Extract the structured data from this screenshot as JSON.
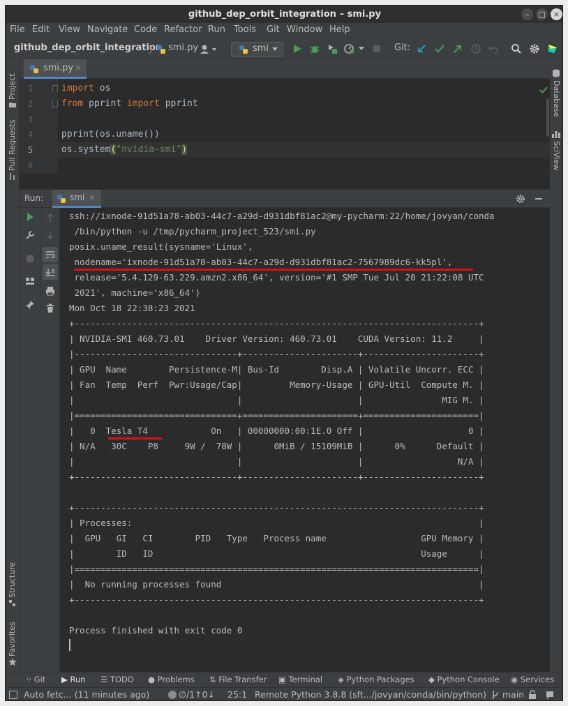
{
  "window": {
    "title": "github_dep_orbit_integration – smi.py",
    "minimize": "–",
    "maximize": "□",
    "close": "×"
  },
  "menu": [
    "File",
    "Edit",
    "View",
    "Navigate",
    "Code",
    "Refactor",
    "Run",
    "Tools",
    "Git",
    "Window",
    "Help"
  ],
  "navbar": {
    "project": "github_dep_orbit_integration",
    "file": "smi.py",
    "run_config": "smi",
    "git_label": "Git:"
  },
  "left_strip": {
    "project": "Project",
    "pull_requests": "Pull Requests",
    "structure": "Structure",
    "favorites": "Favorites"
  },
  "right_strip": {
    "database": "Database",
    "sciview": "SciView"
  },
  "editor": {
    "tab": "smi.py",
    "lines": [
      {
        "n": "1",
        "text": "import os"
      },
      {
        "n": "2",
        "text": "from pprint import pprint"
      },
      {
        "n": "3",
        "text": ""
      },
      {
        "n": "4",
        "text": "pprint(os.uname())"
      },
      {
        "n": "5",
        "text": "os.system(\"nvidia-smi\")"
      },
      {
        "n": "6",
        "text": ""
      }
    ],
    "kw_import": "import",
    "kw_from": "from",
    "mod_os": "os",
    "mod_pprint": "pprint",
    "line4": "pprint(os.uname())",
    "line5_a": "os.system",
    "line5_paren_open": "(",
    "line5_str": "\"nvidia-smi\"",
    "line5_paren_close": ")"
  },
  "run": {
    "label": "Run:",
    "tab": "smi",
    "output": [
      "ssh://ixnode-91d51a78-ab03-44c7-a29d-d931dbf81ac2@my-pycharm:22/home/jovyan/conda",
      " /bin/python -u /tmp/pycharm_project_523/smi.py",
      "posix.uname_result(sysname='Linux',",
      " nodename='ixnode-91d51a78-ab03-44c7-a29d-d931dbf81ac2-7567989dc6-kk5pl',",
      " release='5.4.129-63.229.amzn2.x86_64', version='#1 SMP Tue Jul 20 21:22:08 UTC",
      " 2021', machine='x86_64')",
      "Mon Oct 18 22:38:23 2021",
      "+-----------------------------------------------------------------------------+",
      "| NVIDIA-SMI 460.73.01    Driver Version: 460.73.01    CUDA Version: 11.2     |",
      "|-------------------------------+----------------------+----------------------+",
      "| GPU  Name        Persistence-M| Bus-Id        Disp.A | Volatile Uncorr. ECC |",
      "| Fan  Temp  Perf  Pwr:Usage/Cap|         Memory-Usage | GPU-Util  Compute M. |",
      "|                               |                      |               MIG M. |",
      "|===============================+======================+======================|",
      "|   0  Tesla T4            On   | 00000000:00:1E.0 Off |                    0 |",
      "| N/A   30C    P8     9W /  70W |      0MiB / 15109MiB |      0%      Default |",
      "|                               |                      |                  N/A |",
      "+-------------------------------+----------------------+----------------------+",
      "",
      "+-----------------------------------------------------------------------------+",
      "| Processes:                                                                  |",
      "|  GPU   GI   CI        PID   Type   Process name                  GPU Memory |",
      "|        ID   ID                                                   Usage      |",
      "|=============================================================================|",
      "|  No running processes found                                                 |",
      "+-----------------------------------------------------------------------------+",
      "",
      "Process finished with exit code 0"
    ]
  },
  "bottom_tools": [
    {
      "icon": "git-icon",
      "label": "Git"
    },
    {
      "icon": "run-icon",
      "label": "Run"
    },
    {
      "icon": "todo-icon",
      "label": "TODO"
    },
    {
      "icon": "problems-icon",
      "label": "Problems"
    },
    {
      "icon": "file-transfer-icon",
      "label": "File Transfer"
    },
    {
      "icon": "terminal-icon",
      "label": "Terminal"
    },
    {
      "icon": "python-packages-icon",
      "label": "Python Packages"
    },
    {
      "icon": "python-console-icon",
      "label": "Python Console"
    },
    {
      "icon": "services-icon",
      "label": "Services"
    }
  ],
  "status": {
    "fetch": "Auto fetc... (11 minutes ago)",
    "changes": "∅/1↑0↓",
    "position": "25:1",
    "interpreter": "Remote Python 3.8.8 (sft.../jovyan/conda/bin/python)",
    "branch": "main"
  },
  "colors": {
    "accent_blue": "#4a88c7",
    "run_green": "#499c54",
    "underline_red": "#e01010"
  }
}
